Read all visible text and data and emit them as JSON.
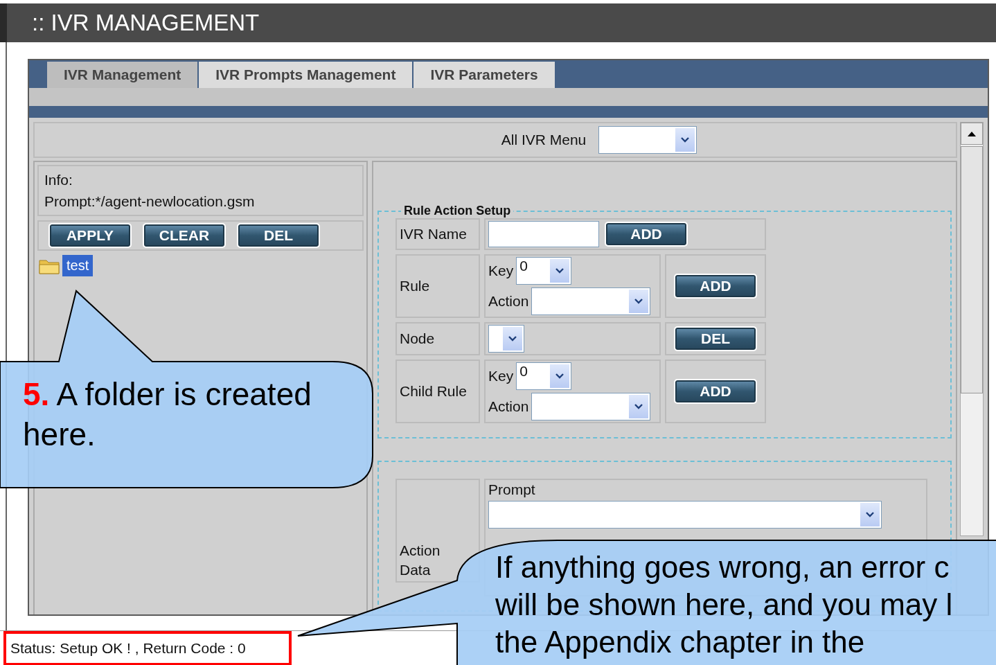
{
  "header": {
    "title": ":: IVR MANAGEMENT"
  },
  "tabs": [
    {
      "label": "IVR Management",
      "selected": true
    },
    {
      "label": "IVR Prompts Management",
      "selected": false
    },
    {
      "label": "IVR Parameters",
      "selected": false
    }
  ],
  "menu_select": {
    "label": "All IVR Menu"
  },
  "info": {
    "lines": [
      "Info:",
      "Prompt:*/agent-newlocation.gsm"
    ]
  },
  "tree_buttons": [
    "APPLY",
    "CLEAR",
    "DEL"
  ],
  "tree": [
    {
      "label": "test",
      "selected": true
    }
  ],
  "rule_setup": {
    "legend": "Rule Action Setup",
    "rows": [
      {
        "kind": "name",
        "label": "IVR Name",
        "button": "ADD"
      },
      {
        "kind": "key_action",
        "label": "Rule",
        "key_label": "Key",
        "key_value": "0",
        "action_label": "Action",
        "button": "ADD"
      },
      {
        "kind": "node",
        "label": "Node",
        "button": "DEL"
      },
      {
        "kind": "key_action",
        "label": "Child Rule",
        "key_label": "Key",
        "key_value": "0",
        "action_label": "Action",
        "button": "ADD"
      }
    ]
  },
  "action_data": {
    "label": "Action Data",
    "prompt_label": "Prompt"
  },
  "status": "Status: Setup OK ! , Return Code : 0",
  "callouts": [
    {
      "kind": "folder",
      "text": "**5.** A folder is created here."
    },
    {
      "kind": "status",
      "lines": [
        "If anything goes wrong, an error c",
        "will be shown here, and you may l",
        "the Appendix chapter in the"
      ]
    }
  ]
}
